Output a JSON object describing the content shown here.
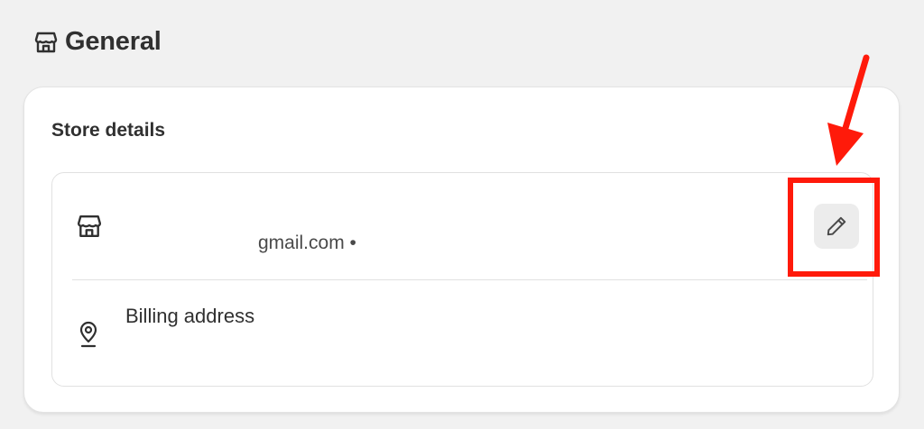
{
  "header": {
    "title": "General",
    "icon": "store-icon"
  },
  "card": {
    "title": "Store details",
    "store_row": {
      "icon": "store-icon",
      "email_text": "gmail.com •",
      "edit_icon": "pencil-icon"
    },
    "billing_row": {
      "icon": "location-pin-icon",
      "label": "Billing address"
    }
  },
  "annotation": {
    "highlight_color": "#ff1a0a",
    "arrow_color": "#ff1a0a"
  }
}
